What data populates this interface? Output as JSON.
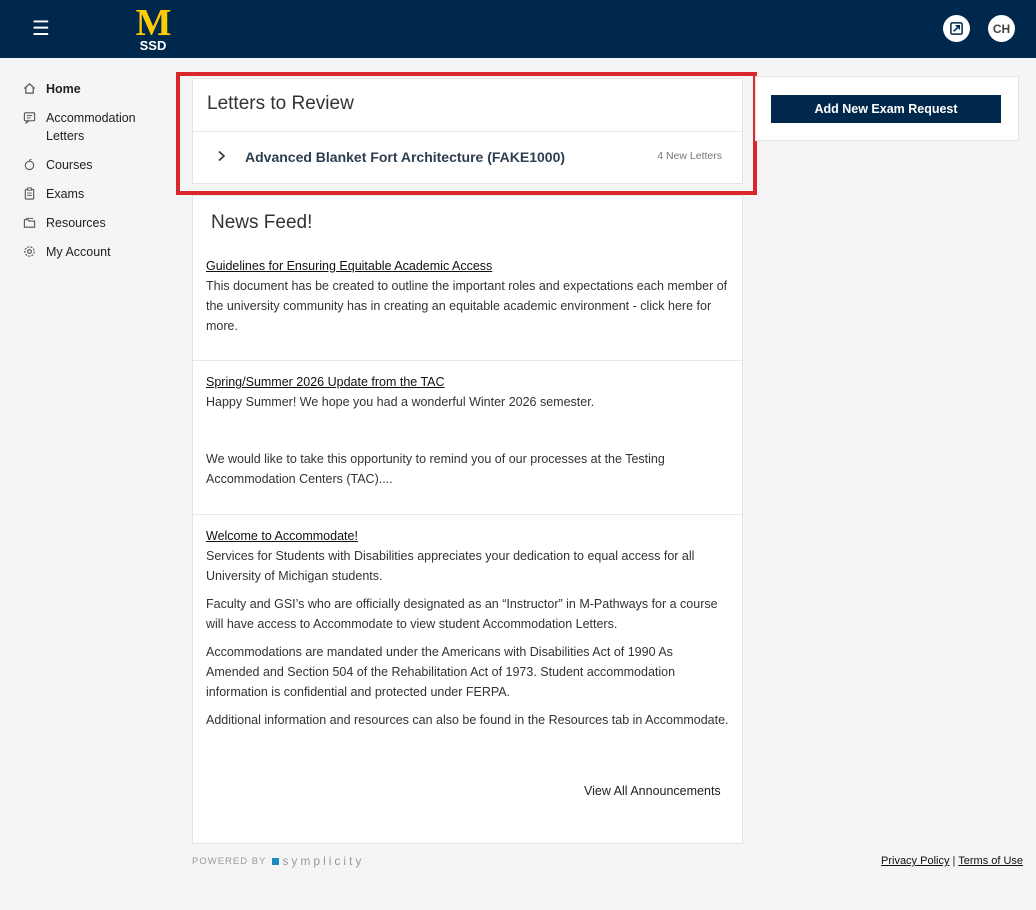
{
  "header": {
    "menu_icon": "hamburger-icon",
    "logo_letter": "M",
    "logo_sub": "SSD",
    "switch_icon": "switch-view-icon",
    "avatar_initials": "CH",
    "brand_color": "#00274c",
    "logo_color": "#ffcb05"
  },
  "sidebar": {
    "items": [
      {
        "label": "Home",
        "icon": "home-icon",
        "active": true
      },
      {
        "label": "Accommodation Letters",
        "icon": "letters-icon"
      },
      {
        "label": "Courses",
        "icon": "courses-icon"
      },
      {
        "label": "Exams",
        "icon": "exams-icon"
      },
      {
        "label": "Resources",
        "icon": "resources-icon"
      },
      {
        "label": "My Account",
        "icon": "gear-icon"
      }
    ]
  },
  "letters": {
    "title": "Letters to Review",
    "course": "Advanced Blanket Fort Architecture (FAKE1000)",
    "count_label": "4 New Letters",
    "highlight_color": "#d9272e"
  },
  "news": {
    "title": "News Feed!",
    "items": [
      {
        "heading": "Guidelines for Ensuring Equitable Academic Access",
        "paragraphs": [
          "This document has be created to outline the important roles and expectations each member of the university community has in creating an equitable academic environment - click here for more."
        ]
      },
      {
        "heading": "Spring/Summer 2026 Update from the TAC",
        "paragraphs": [
          "Happy Summer! We hope you had a wonderful Winter 2026 semester.",
          "We would like to take this opportunity to remind you of our processes at the Testing Accommodation Centers (TAC)...."
        ]
      },
      {
        "heading": "Welcome to Accommodate!",
        "paragraphs": [
          "Services for Students with Disabilities appreciates your dedication to equal access for all University of Michigan students.",
          "Faculty and GSI’s who are officially designated as an “Instructor” in M-Pathways for a course will have access to Accommodate to view student Accommodation Letters.",
          "Accommodations are mandated under the Americans with Disabilities Act of 1990 As Amended and Section 504 of the Rehabilitation Act of 1973. Student accommodation information is confidential and protected under FERPA.",
          "Additional information and resources can also be found in the Resources tab in Accommodate."
        ]
      }
    ],
    "view_all": "View All Announcements"
  },
  "right": {
    "exam_button": "Add New Exam Request"
  },
  "footer": {
    "powered_by": "POWERED BY",
    "brand": "symplicity",
    "privacy": "Privacy Policy",
    "separator": "|",
    "terms": "Terms of Use"
  }
}
